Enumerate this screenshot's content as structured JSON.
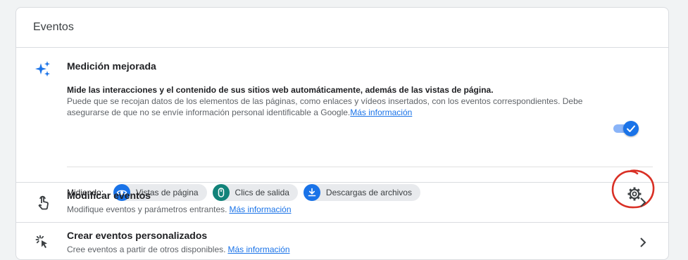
{
  "card": {
    "title": "Eventos"
  },
  "enhanced": {
    "icon": "sparkle-icon",
    "title": "Medición mejorada",
    "description_lead": "Mide las interacciones y el contenido de sus sitios web automáticamente, además de las vistas de página.",
    "description_body": "Puede que se recojan datos de los elementos de las páginas, como enlaces y vídeos insertados, con los eventos correspondientes. Debe asegurarse de que no se envíe información personal identificable a Google.",
    "link": "Más información",
    "toggle_on": true,
    "measuring_label": "Midiendo:",
    "chips": [
      {
        "icon": "eye-icon",
        "label": "Vistas de página",
        "color": "#1a73e8"
      },
      {
        "icon": "mouse-icon",
        "label": "Clics de salida",
        "color": "#12837a"
      },
      {
        "icon": "download-icon",
        "label": "Descargas de archivos",
        "color": "#1a73e8"
      }
    ],
    "settings_icon": "gear-icon"
  },
  "rows": [
    {
      "icon": "touch-icon",
      "title": "Modificar eventos",
      "subtitle": "Modifique eventos y parámetros entrantes.",
      "link": "Más información"
    },
    {
      "icon": "click-icon",
      "title": "Crear eventos personalizados",
      "subtitle": "Cree eventos a partir de otros disponibles.",
      "link": "Más información"
    }
  ],
  "colors": {
    "accent": "#1a73e8",
    "annotation": "#d93025"
  }
}
